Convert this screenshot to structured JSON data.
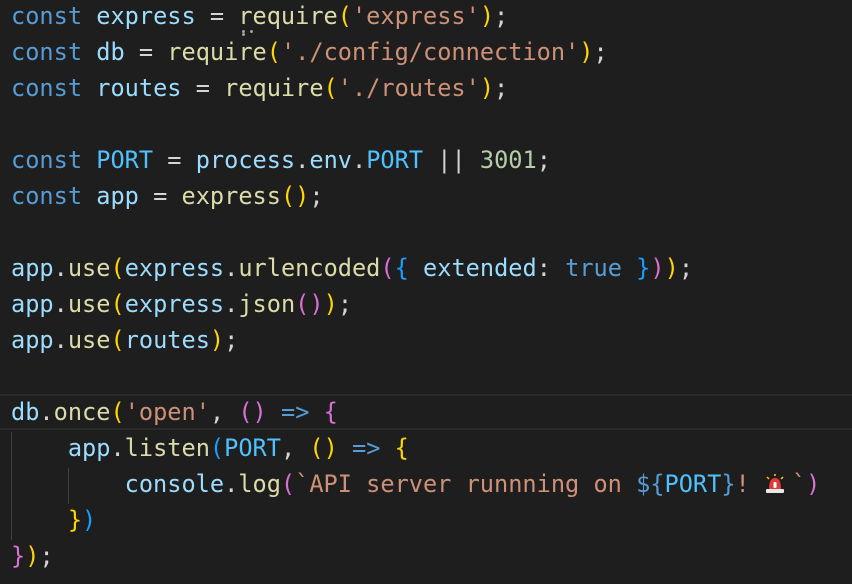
{
  "editor": {
    "language": "javascript",
    "colors": {
      "background": "#1e1e1e",
      "keyword": "#569cd6",
      "variable": "#9cdcfe",
      "constant": "#4fc1ff",
      "function": "#dcdcaa",
      "string": "#ce9178",
      "number": "#b5cea8",
      "operator": "#d4d4d4",
      "bracket_gold": "#ffd700",
      "bracket_purple": "#da70d6",
      "bracket_blue": "#179fff"
    },
    "lines": [
      [
        {
          "t": "const",
          "c": "#569cd6"
        },
        {
          "t": " ",
          "c": "#d4d4d4"
        },
        {
          "t": "express",
          "c": "#9cdcfe"
        },
        {
          "t": " = ",
          "c": "#d4d4d4"
        },
        {
          "t": "require",
          "c": "#dcdcaa"
        },
        {
          "t": "(",
          "c": "#ffd700"
        },
        {
          "t": "'express'",
          "c": "#ce9178"
        },
        {
          "t": ")",
          "c": "#ffd700"
        },
        {
          "t": ";",
          "c": "#d4d4d4"
        }
      ],
      [
        {
          "t": "const",
          "c": "#569cd6"
        },
        {
          "t": " ",
          "c": "#d4d4d4"
        },
        {
          "t": "db",
          "c": "#9cdcfe"
        },
        {
          "t": " = ",
          "c": "#d4d4d4"
        },
        {
          "t": "require",
          "c": "#dcdcaa"
        },
        {
          "t": "(",
          "c": "#ffd700"
        },
        {
          "t": "'./config/connection'",
          "c": "#ce9178"
        },
        {
          "t": ")",
          "c": "#ffd700"
        },
        {
          "t": ";",
          "c": "#d4d4d4"
        }
      ],
      [
        {
          "t": "const",
          "c": "#569cd6"
        },
        {
          "t": " ",
          "c": "#d4d4d4"
        },
        {
          "t": "routes",
          "c": "#9cdcfe"
        },
        {
          "t": " = ",
          "c": "#d4d4d4"
        },
        {
          "t": "require",
          "c": "#dcdcaa"
        },
        {
          "t": "(",
          "c": "#ffd700"
        },
        {
          "t": "'./routes'",
          "c": "#ce9178"
        },
        {
          "t": ")",
          "c": "#ffd700"
        },
        {
          "t": ";",
          "c": "#d4d4d4"
        }
      ],
      [],
      [
        {
          "t": "const",
          "c": "#569cd6"
        },
        {
          "t": " ",
          "c": "#d4d4d4"
        },
        {
          "t": "PORT",
          "c": "#4fc1ff"
        },
        {
          "t": " = ",
          "c": "#d4d4d4"
        },
        {
          "t": "process",
          "c": "#9cdcfe"
        },
        {
          "t": ".",
          "c": "#d4d4d4"
        },
        {
          "t": "env",
          "c": "#9cdcfe"
        },
        {
          "t": ".",
          "c": "#d4d4d4"
        },
        {
          "t": "PORT",
          "c": "#4fc1ff"
        },
        {
          "t": " || ",
          "c": "#d4d4d4"
        },
        {
          "t": "3001",
          "c": "#b5cea8"
        },
        {
          "t": ";",
          "c": "#d4d4d4"
        }
      ],
      [
        {
          "t": "const",
          "c": "#569cd6"
        },
        {
          "t": " ",
          "c": "#d4d4d4"
        },
        {
          "t": "app",
          "c": "#9cdcfe"
        },
        {
          "t": " = ",
          "c": "#d4d4d4"
        },
        {
          "t": "express",
          "c": "#dcdcaa"
        },
        {
          "t": "()",
          "c": "#ffd700"
        },
        {
          "t": ";",
          "c": "#d4d4d4"
        }
      ],
      [],
      [
        {
          "t": "app",
          "c": "#9cdcfe"
        },
        {
          "t": ".",
          "c": "#d4d4d4"
        },
        {
          "t": "use",
          "c": "#dcdcaa"
        },
        {
          "t": "(",
          "c": "#ffd700"
        },
        {
          "t": "express",
          "c": "#9cdcfe"
        },
        {
          "t": ".",
          "c": "#d4d4d4"
        },
        {
          "t": "urlencoded",
          "c": "#dcdcaa"
        },
        {
          "t": "(",
          "c": "#da70d6"
        },
        {
          "t": "{",
          "c": "#179fff"
        },
        {
          "t": " ",
          "c": "#d4d4d4"
        },
        {
          "t": "extended",
          "c": "#9cdcfe"
        },
        {
          "t": ": ",
          "c": "#d4d4d4"
        },
        {
          "t": "true",
          "c": "#569cd6"
        },
        {
          "t": " ",
          "c": "#d4d4d4"
        },
        {
          "t": "}",
          "c": "#179fff"
        },
        {
          "t": ")",
          "c": "#da70d6"
        },
        {
          "t": ")",
          "c": "#ffd700"
        },
        {
          "t": ";",
          "c": "#d4d4d4"
        }
      ],
      [
        {
          "t": "app",
          "c": "#9cdcfe"
        },
        {
          "t": ".",
          "c": "#d4d4d4"
        },
        {
          "t": "use",
          "c": "#dcdcaa"
        },
        {
          "t": "(",
          "c": "#ffd700"
        },
        {
          "t": "express",
          "c": "#9cdcfe"
        },
        {
          "t": ".",
          "c": "#d4d4d4"
        },
        {
          "t": "json",
          "c": "#dcdcaa"
        },
        {
          "t": "()",
          "c": "#da70d6"
        },
        {
          "t": ")",
          "c": "#ffd700"
        },
        {
          "t": ";",
          "c": "#d4d4d4"
        }
      ],
      [
        {
          "t": "app",
          "c": "#9cdcfe"
        },
        {
          "t": ".",
          "c": "#d4d4d4"
        },
        {
          "t": "use",
          "c": "#dcdcaa"
        },
        {
          "t": "(",
          "c": "#ffd700"
        },
        {
          "t": "routes",
          "c": "#9cdcfe"
        },
        {
          "t": ")",
          "c": "#ffd700"
        },
        {
          "t": ";",
          "c": "#d4d4d4"
        }
      ],
      [],
      [
        {
          "t": "db",
          "c": "#9cdcfe"
        },
        {
          "t": ".",
          "c": "#d4d4d4"
        },
        {
          "t": "once",
          "c": "#dcdcaa"
        },
        {
          "t": "(",
          "c": "#ffd700"
        },
        {
          "t": "'open'",
          "c": "#ce9178"
        },
        {
          "t": ", ",
          "c": "#d4d4d4"
        },
        {
          "t": "()",
          "c": "#da70d6"
        },
        {
          "t": " ",
          "c": "#d4d4d4"
        },
        {
          "t": "=>",
          "c": "#569cd6"
        },
        {
          "t": " ",
          "c": "#d4d4d4"
        },
        {
          "t": "{",
          "c": "#da70d6"
        }
      ],
      [
        {
          "t": "    ",
          "c": "#d4d4d4"
        },
        {
          "t": "app",
          "c": "#9cdcfe"
        },
        {
          "t": ".",
          "c": "#d4d4d4"
        },
        {
          "t": "listen",
          "c": "#dcdcaa"
        },
        {
          "t": "(",
          "c": "#179fff"
        },
        {
          "t": "PORT",
          "c": "#4fc1ff"
        },
        {
          "t": ", ",
          "c": "#d4d4d4"
        },
        {
          "t": "()",
          "c": "#ffd700"
        },
        {
          "t": " ",
          "c": "#d4d4d4"
        },
        {
          "t": "=>",
          "c": "#569cd6"
        },
        {
          "t": " ",
          "c": "#d4d4d4"
        },
        {
          "t": "{",
          "c": "#ffd700"
        }
      ],
      [
        {
          "t": "        ",
          "c": "#d4d4d4"
        },
        {
          "t": "console",
          "c": "#9cdcfe"
        },
        {
          "t": ".",
          "c": "#d4d4d4"
        },
        {
          "t": "log",
          "c": "#dcdcaa"
        },
        {
          "t": "(",
          "c": "#da70d6"
        },
        {
          "t": "`API server runnning on ",
          "c": "#ce9178"
        },
        {
          "t": "${",
          "c": "#569cd6"
        },
        {
          "t": "PORT",
          "c": "#4fc1ff"
        },
        {
          "t": "}",
          "c": "#569cd6"
        },
        {
          "t": "! ",
          "c": "#ce9178"
        },
        {
          "t": "🚨",
          "c": "#ce9178",
          "emoji": "police-light-icon"
        },
        {
          "t": "`",
          "c": "#ce9178"
        },
        {
          "t": ")",
          "c": "#da70d6"
        }
      ],
      [
        {
          "t": "    ",
          "c": "#d4d4d4"
        },
        {
          "t": "}",
          "c": "#ffd700"
        },
        {
          "t": ")",
          "c": "#179fff"
        }
      ],
      [
        {
          "t": "}",
          "c": "#da70d6"
        },
        {
          "t": ")",
          "c": "#ffd700"
        },
        {
          "t": ";",
          "c": "#d4d4d4"
        }
      ]
    ]
  }
}
